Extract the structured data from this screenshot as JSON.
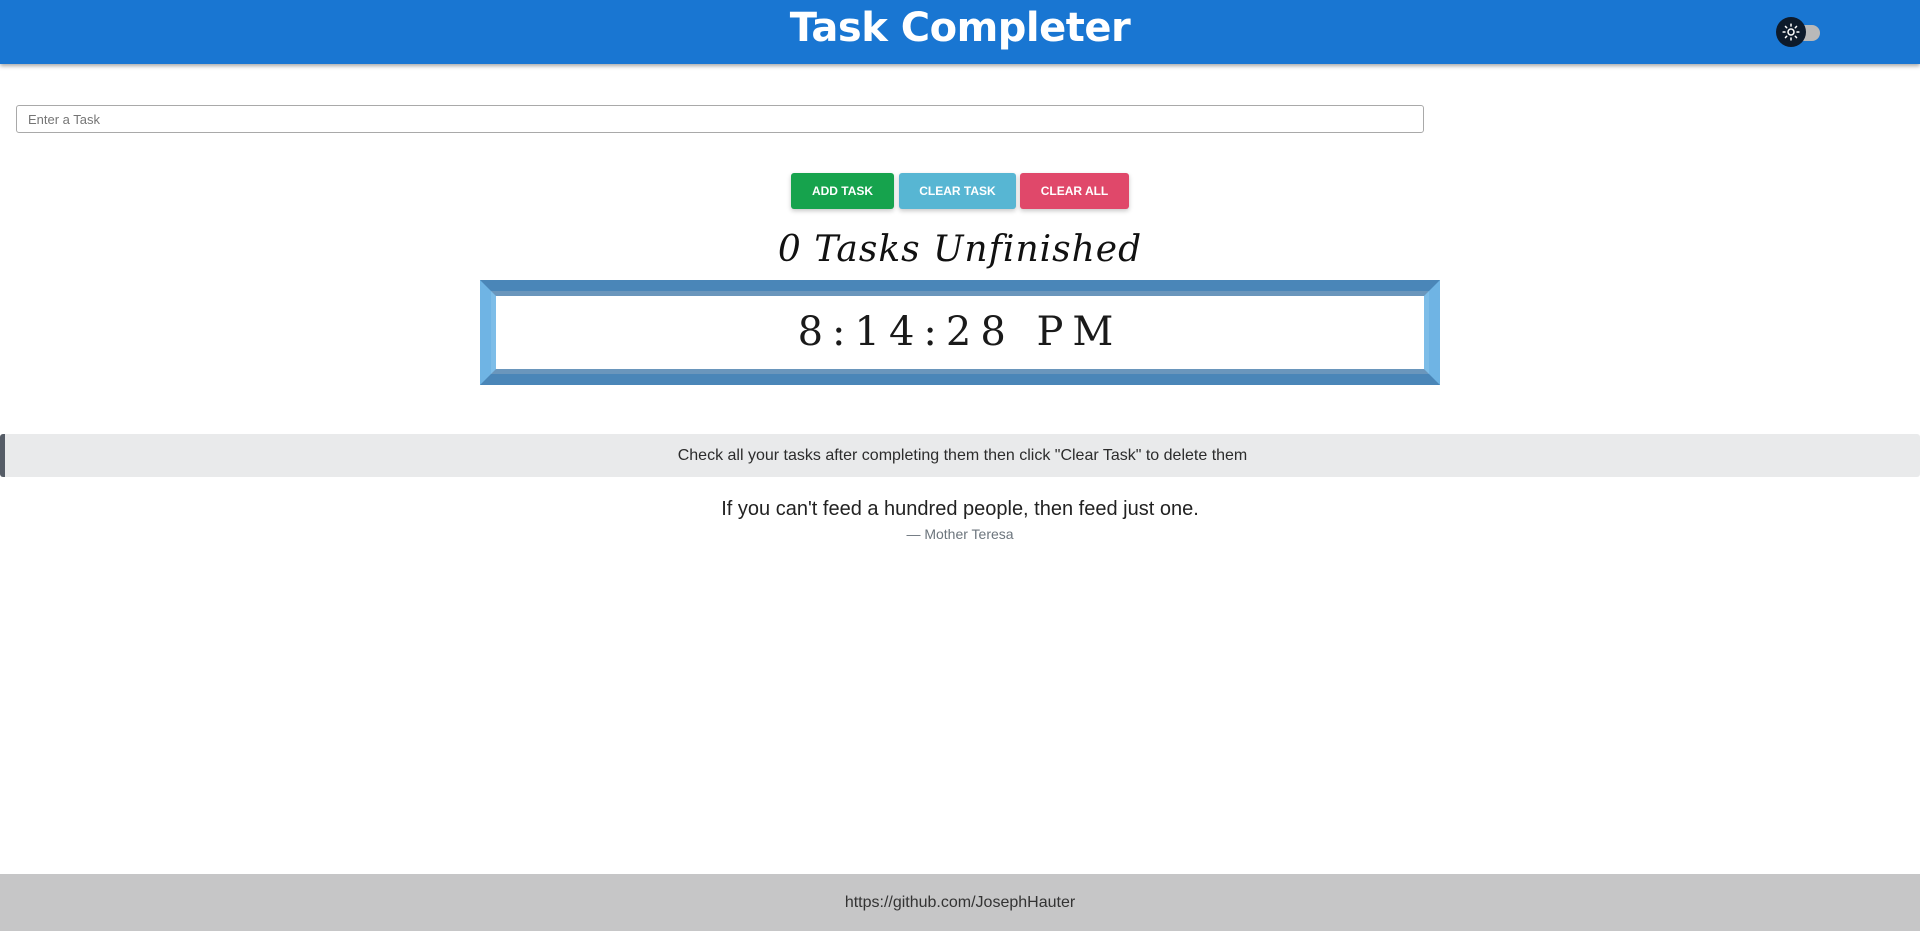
{
  "header": {
    "title": "Task Completer",
    "theme_toggle_icon": "sun-icon"
  },
  "task_input": {
    "placeholder": "Enter a Task",
    "value": ""
  },
  "buttons": {
    "add_task": "ADD TASK",
    "clear_task": "CLEAR TASK",
    "clear_all": "CLEAR ALL"
  },
  "status": {
    "unfinished": "0 Tasks Unfinished"
  },
  "clock": {
    "time": "8:14:28 PM"
  },
  "info": {
    "message": "Check all your tasks after completing them then click \"Clear Task\" to delete them"
  },
  "quote": {
    "text": "If you can't feed a hundred people, then feed just one.",
    "author": "— Mother Teresa"
  },
  "footer": {
    "link": "https://github.com/JosephHauter"
  },
  "colors": {
    "header_bg": "#1976d2",
    "add_task": "#16a34d",
    "clear_task": "#57b6d3",
    "clear_all": "#e0486a",
    "clock_border": "#6fb4e4",
    "footer_bg": "#c6c6c7"
  }
}
